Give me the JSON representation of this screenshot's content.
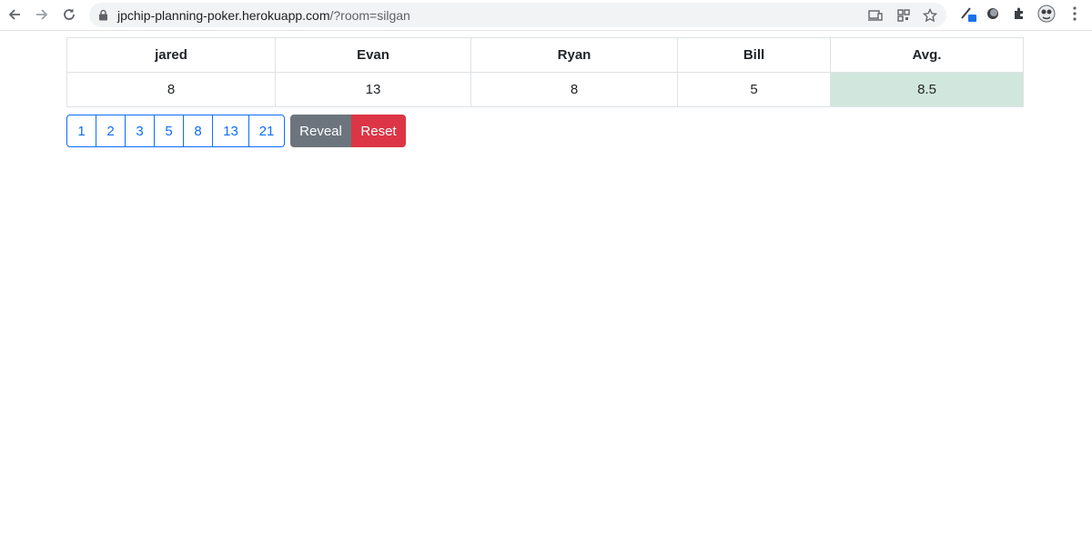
{
  "browser": {
    "url_host": "jpchip-planning-poker.herokuapp.com",
    "url_path": "/?room=silgan"
  },
  "table": {
    "headers": [
      "jared",
      "Evan",
      "Ryan",
      "Bill",
      "Avg."
    ],
    "votes": [
      "8",
      "13",
      "8",
      "5"
    ],
    "average": "8.5"
  },
  "cards": [
    "1",
    "2",
    "3",
    "5",
    "8",
    "13",
    "21"
  ],
  "actions": {
    "reveal_label": "Reveal",
    "reset_label": "Reset"
  },
  "colors": {
    "primary": "#0d6efd",
    "secondary": "#6c757d",
    "danger": "#dc3545",
    "average_bg": "#d1e7dd"
  }
}
